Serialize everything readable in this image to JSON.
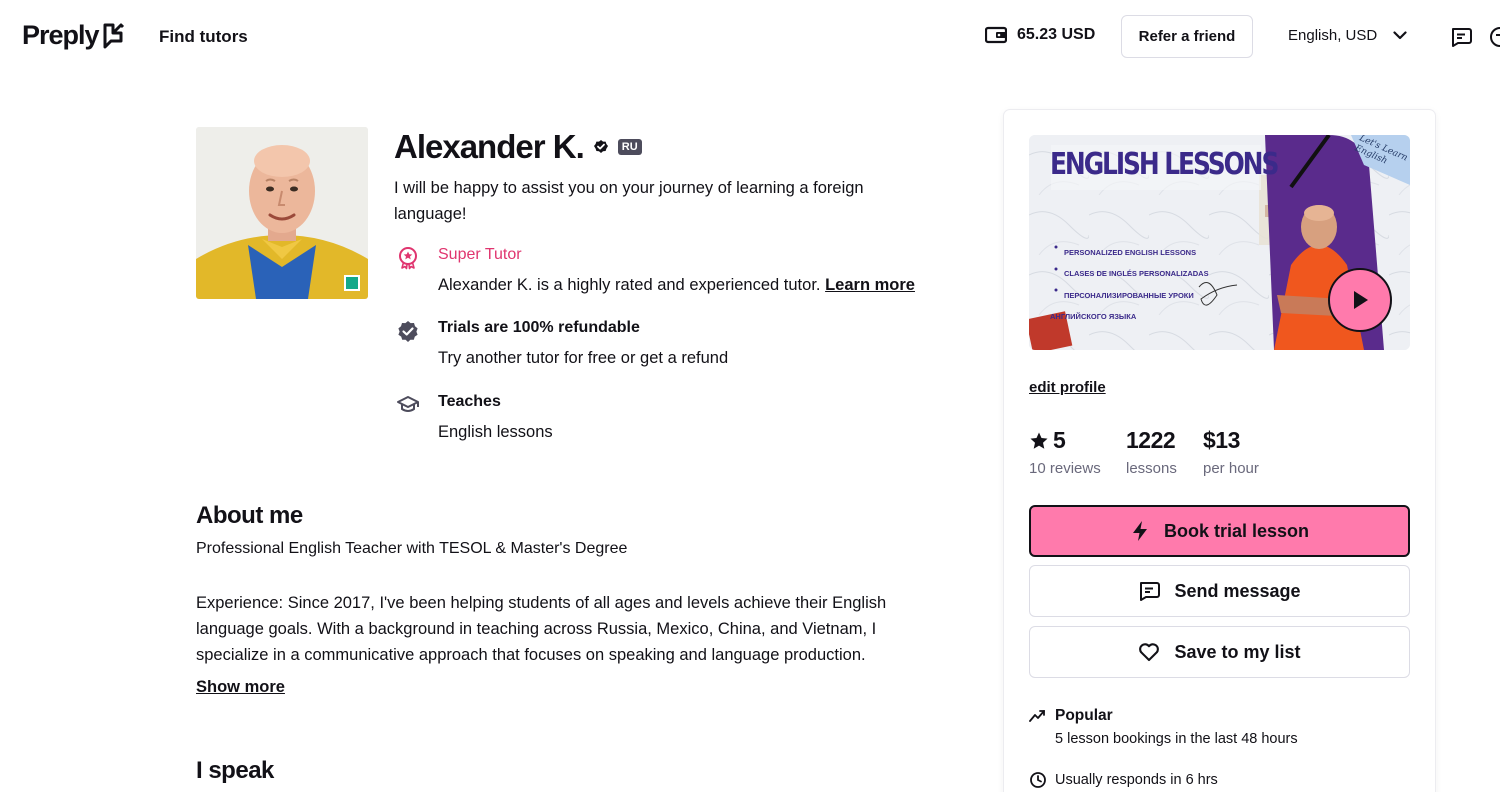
{
  "header": {
    "logo": "Preply",
    "find_tutors": "Find tutors",
    "balance": "65.23 USD",
    "refer_button": "Refer a friend",
    "language_currency": "English, USD"
  },
  "tutor": {
    "name": "Alexander K.",
    "country_badge": "RU",
    "headline": "I will be happy to assist you on your journey of learning a foreign language!",
    "features": [
      {
        "title": "Super Tutor",
        "desc": "Alexander K. is a highly rated and experienced tutor.",
        "link": "Learn more",
        "icon": "super-tutor-icon",
        "color": "#e0356f"
      },
      {
        "title": "Trials are 100% refundable",
        "desc": "Try another tutor for free or get a refund",
        "icon": "shield-check-icon"
      },
      {
        "title": "Teaches",
        "desc": "English lessons",
        "icon": "graduation-cap-icon"
      }
    ]
  },
  "about": {
    "title": "About me",
    "subtitle": "Professional English Teacher with TESOL & Master's Degree",
    "body": "Experience: Since 2017, I've been helping students of all ages and levels achieve their English language goals. With a background in teaching across Russia, Mexico, China, and Vietnam, I specialize in a communicative approach that focuses on speaking and language production.",
    "show_more": "Show more"
  },
  "languages": {
    "title": "I speak"
  },
  "card": {
    "video": {
      "heading": "ENGLISH LESSONS",
      "corner_tag": "Let's Learn English",
      "bullets": [
        "PERSONALIZED ENGLISH LESSONS",
        "CLASES DE INGLÉS PERSONALIZADAS",
        "ПЕРСОНАЛИЗИРОВАННЫЕ УРОКИ",
        "АНГЛИЙСКОГО ЯЗЫКА"
      ]
    },
    "edit_profile": "edit profile",
    "stats": [
      {
        "value": "5",
        "label": "10 reviews",
        "icon": "star-icon"
      },
      {
        "value": "1222",
        "label": "lessons"
      },
      {
        "value": "$13",
        "label": "per hour"
      }
    ],
    "book_trial": "Book trial lesson",
    "send_message": "Send message",
    "save_list": "Save to my list",
    "popular_title": "Popular",
    "popular_desc": "5 lesson bookings in the last 48 hours",
    "response": "Usually responds in 6 hrs"
  },
  "colors": {
    "accent": "#ff7aac",
    "super_tutor": "#e0356f",
    "muted": "#6a697c",
    "online": "#14a88a"
  }
}
